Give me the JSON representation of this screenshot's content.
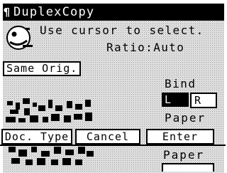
{
  "title": {
    "icon": "¶",
    "text": "DuplexCopy"
  },
  "message": {
    "line1": "Use cursor to select.",
    "line2": "Ratio:Auto"
  },
  "same_orig": "Same Orig.",
  "bind": {
    "label": "Bind",
    "left": "L",
    "right": "R"
  },
  "paper": {
    "label_top": "Paper",
    "label_bottom": "Paper"
  },
  "softkeys": {
    "doc_type": "Doc. Type",
    "cancel": "Cancel",
    "enter": "Enter"
  }
}
